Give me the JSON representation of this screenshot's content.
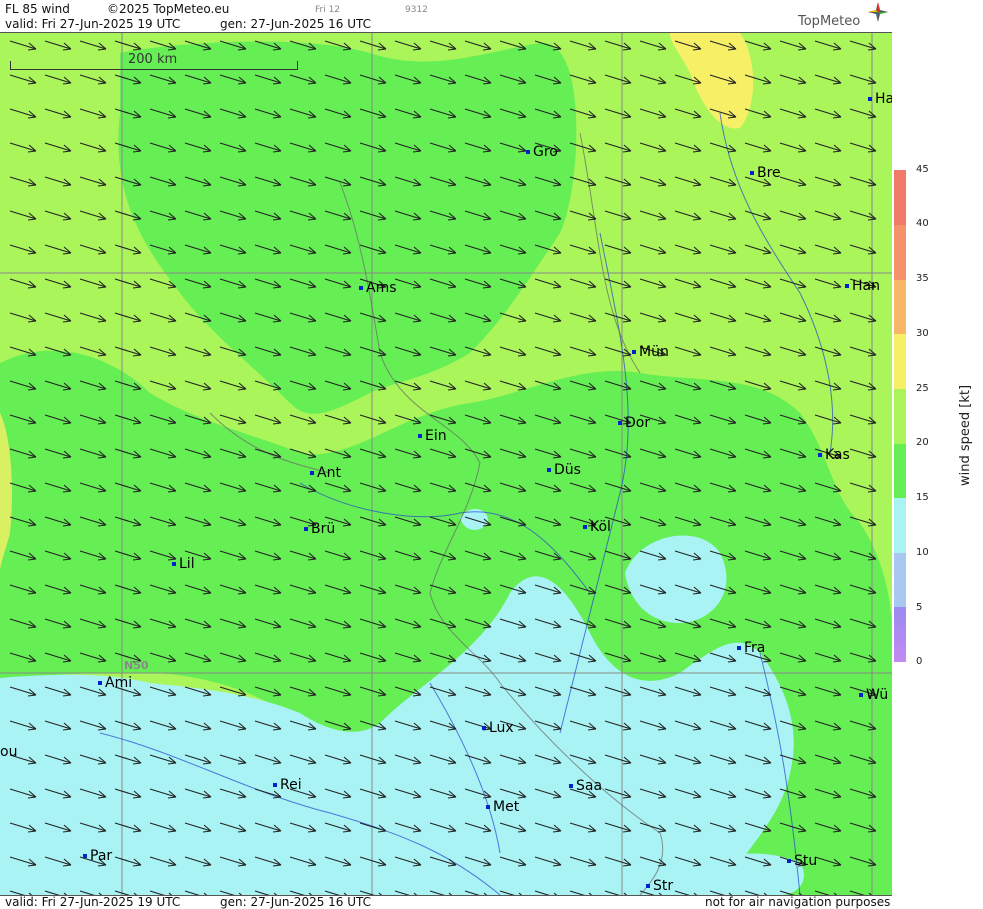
{
  "header": {
    "product": "FL 85 wind",
    "copyright": "©2025 TopMeteo.eu",
    "valid": "valid:  Fri  27-Jun-2025  19 UTC",
    "gen": "gen: 27-Jun-2025 16 UTC",
    "day_tab": "Fri 12",
    "code": "9312"
  },
  "brand": {
    "name": "TopMeteo"
  },
  "map": {
    "scale_label": "200 km",
    "lat_label": "N50",
    "cities": [
      {
        "label": "Gro"
      },
      {
        "label": "Ams"
      },
      {
        "label": "Bre"
      },
      {
        "label": "Ha"
      },
      {
        "label": "Han"
      },
      {
        "label": "Mün"
      },
      {
        "label": "Dor"
      },
      {
        "label": "Ein"
      },
      {
        "label": "Ant"
      },
      {
        "label": "Düs"
      },
      {
        "label": "Kas"
      },
      {
        "label": "Brü"
      },
      {
        "label": "Köl"
      },
      {
        "label": "Lil"
      },
      {
        "label": "Fra"
      },
      {
        "label": "Ami"
      },
      {
        "label": "Wü"
      },
      {
        "label": "Lux"
      },
      {
        "label": "Rei"
      },
      {
        "label": "Saa"
      },
      {
        "label": "Met"
      },
      {
        "label": "Stu"
      },
      {
        "label": "Par"
      },
      {
        "label": "Str"
      },
      {
        "label": "ou"
      }
    ],
    "colors": {
      "lightgreen": "#aaf55a",
      "green": "#66ee55",
      "cyan": "#aaf3f5",
      "yellow": "#f7f066",
      "arrow": "#222222"
    }
  },
  "legend": {
    "title": "wind  speed  [kt]",
    "ticks": [
      "45",
      "40",
      "35",
      "30",
      "25",
      "20",
      "15",
      "10",
      "5",
      "0"
    ],
    "colors": [
      "#f07a6a",
      "#f4926a",
      "#f7b766",
      "#f7f066",
      "#aaf55a",
      "#66ee55",
      "#aaf3f5",
      "#a8c8f2",
      "#9a8af0",
      "#c28af2"
    ]
  },
  "footer": {
    "valid": "valid:  Fri  27-Jun-2025  19 UTC",
    "gen": "gen: 27-Jun-2025 16 UTC",
    "disclaimer": "not for air navigation purposes"
  }
}
